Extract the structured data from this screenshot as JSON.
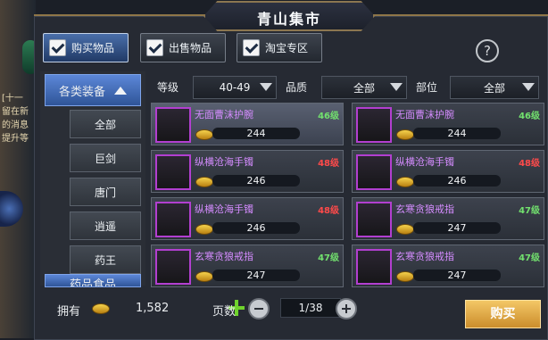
{
  "background": {
    "left_text": "[十一\n留在新\n的消息\n提升等"
  },
  "window": {
    "title": "青山集市"
  },
  "tabs": [
    {
      "label": "购买物品",
      "active": true
    },
    {
      "label": "出售物品",
      "active": false
    },
    {
      "label": "淘宝专区",
      "active": false
    }
  ],
  "help_button": {
    "label": "?"
  },
  "categories": {
    "group_equipment": "各类装备",
    "items": [
      "全部",
      "巨剑",
      "唐门",
      "逍遥",
      "药王"
    ],
    "group_medicine": "药品食品"
  },
  "filters": {
    "level_label": "等级",
    "level_value": "40-49",
    "quality_label": "品质",
    "quality_value": "全部",
    "part_label": "部位",
    "part_value": "全部"
  },
  "items": [
    {
      "name": "无面曹沫护腕",
      "level": "46级",
      "price": "244",
      "icon": "bracer-icon",
      "level_color": "#72e16e"
    },
    {
      "name": "无面曹沫护腕",
      "level": "46级",
      "price": "244",
      "icon": "bracer-icon",
      "level_color": "#72e16e"
    },
    {
      "name": "纵横沧海手镯",
      "level": "48级",
      "price": "246",
      "icon": "bracelet-icon",
      "level_color": "#ff4a4a"
    },
    {
      "name": "纵横沧海手镯",
      "level": "48级",
      "price": "246",
      "icon": "bracelet-icon",
      "level_color": "#ff4a4a"
    },
    {
      "name": "纵横沧海手镯",
      "level": "48级",
      "price": "246",
      "icon": "bracelet-icon",
      "level_color": "#ff4a4a"
    },
    {
      "name": "玄寒贪狼戒指",
      "level": "47级",
      "price": "247",
      "icon": "ring-icon",
      "level_color": "#72e16e"
    },
    {
      "name": "玄寒贪狼戒指",
      "level": "47级",
      "price": "247",
      "icon": "ring-icon",
      "level_color": "#72e16e"
    },
    {
      "name": "玄寒贪狼戒指",
      "level": "47级",
      "price": "247",
      "icon": "ring-icon",
      "level_color": "#72e16e"
    }
  ],
  "footer": {
    "owned_label": "拥有",
    "owned_amount": "1,582",
    "page_label": "页数",
    "page_value": "1/38",
    "buy_label": "购买"
  }
}
